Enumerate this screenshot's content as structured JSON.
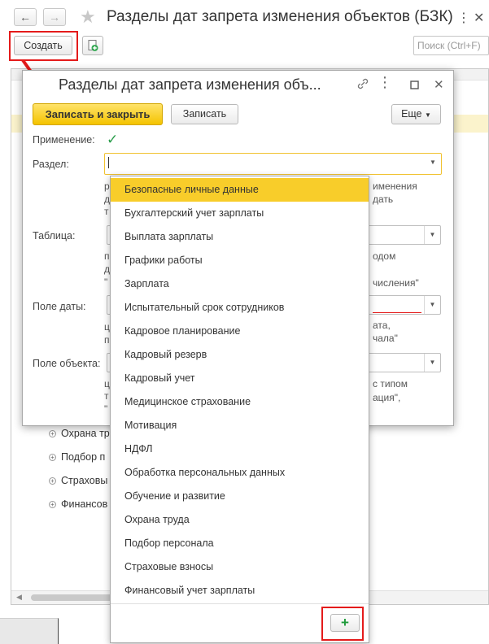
{
  "window": {
    "title": "Разделы дат запрета изменения объектов (БЗК)",
    "back_icon": "←",
    "forward_icon": "→",
    "star_icon": "★",
    "more_icon": "⋮",
    "close_icon": "✕"
  },
  "toolbar": {
    "create_label": "Создать",
    "search_placeholder": "Поиск (Ctrl+F)"
  },
  "list": {
    "rows": [
      "Охрана тр",
      "Подбор п",
      "Страховы",
      "Финансов"
    ]
  },
  "dialog": {
    "title": "Разделы дат запрета изменения объ...",
    "save_close_label": "Записать и закрыть",
    "save_label": "Записать",
    "more_label": "Еще",
    "usage_label": "Применение:",
    "section_label": "Раздел:",
    "table_label": "Таблица:",
    "date_field_label": "Поле даты:",
    "object_field_label": "Поле объекта:",
    "hints": {
      "h1": "именения",
      "h2": "дать",
      "h3": "одом",
      "h4": "числения\"",
      "h5": "ата,",
      "h6": "чала\"",
      "h7": "с типом",
      "h8": "ация\","
    }
  },
  "dropdown": {
    "items": [
      "Безопасные личные данные",
      "Бухгалтерский учет зарплаты",
      "Выплата зарплаты",
      "Графики работы",
      "Зарплата",
      "Испытательный срок сотрудников",
      "Кадровое планирование",
      "Кадровый резерв",
      "Кадровый учет",
      "Медицинское страхование",
      "Мотивация",
      "НДФЛ",
      "Обработка персональных данных",
      "Обучение и развитие",
      "Охрана труда",
      "Подбор персонала",
      "Страховые взносы",
      "Финансовый учет зарплаты"
    ],
    "selected_index": 0,
    "add_icon": "+"
  },
  "colors": {
    "accent_yellow": "#f8cd2a",
    "highlight_red": "#e41b1b",
    "check_green": "#2a9d4b"
  }
}
